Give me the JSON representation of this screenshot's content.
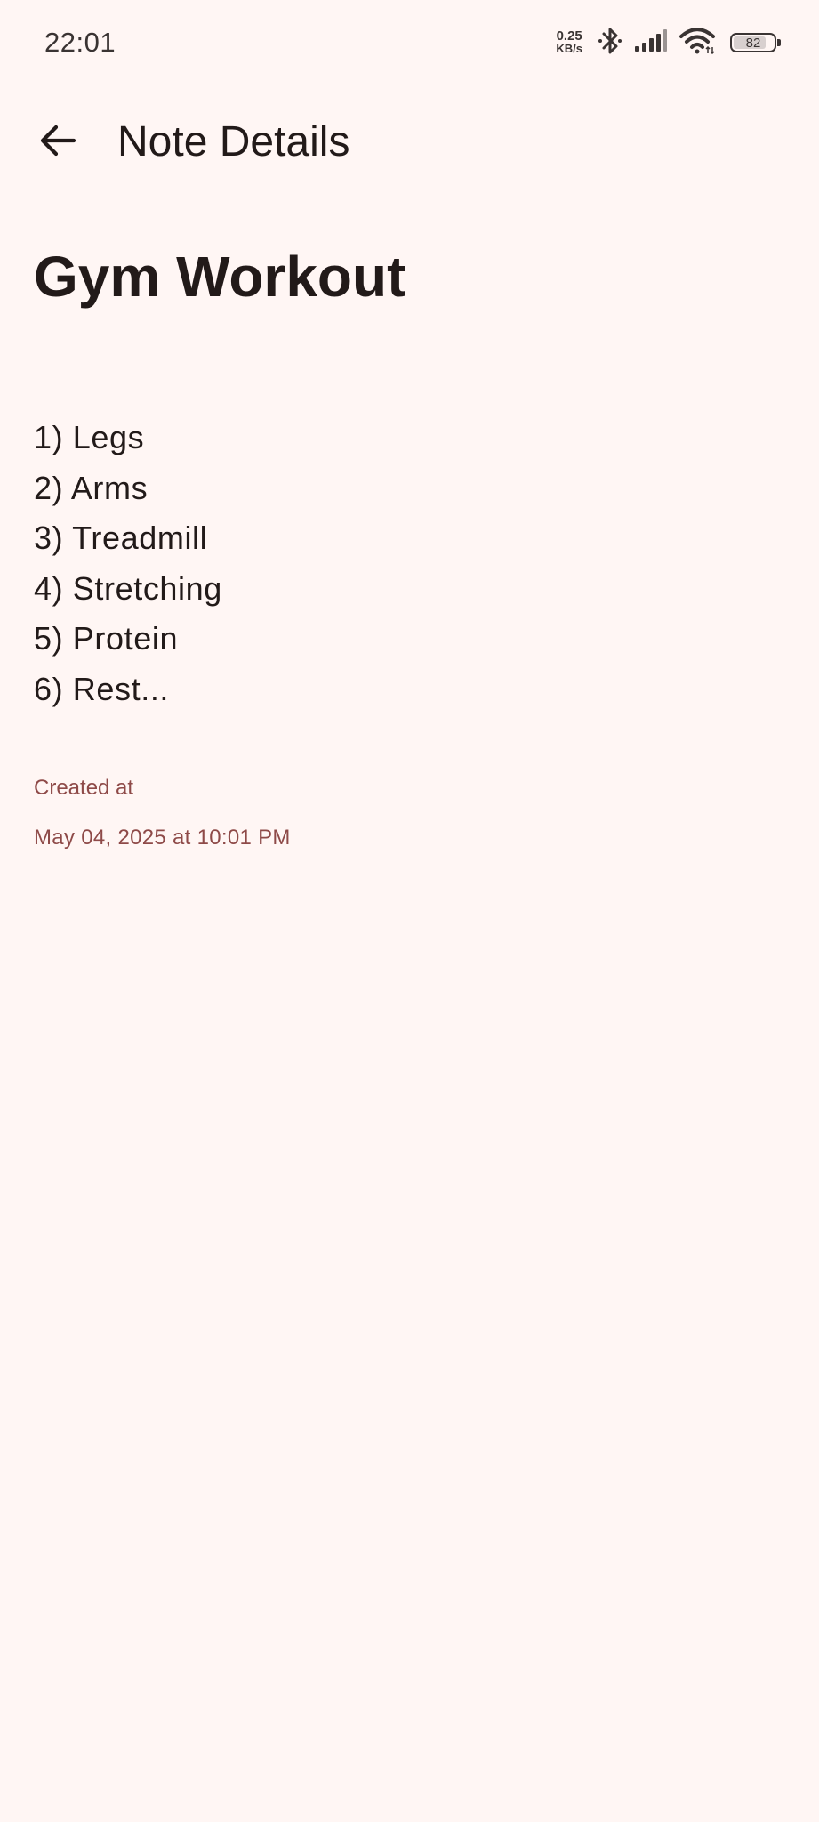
{
  "status_bar": {
    "time": "22:01",
    "net_speed_value": "0.25",
    "net_speed_unit": "KB/s",
    "battery_level": "82",
    "battery_fraction": 0.82,
    "icons": [
      "bluetooth-icon",
      "cellular-signal-icon",
      "wifi-icon",
      "battery-icon"
    ]
  },
  "app_bar": {
    "back_icon": "arrow-back-icon",
    "title": "Note Details"
  },
  "note": {
    "title": "Gym Workout",
    "lines": [
      "1) Legs",
      "2) Arms",
      "3) Treadmill",
      "4) Stretching",
      "5) Protein",
      "6) Rest..."
    ],
    "created_label": "Created at",
    "created_value": "May 04, 2025 at 10:01 PM"
  },
  "colors": {
    "background": "#FFF6F4",
    "text_primary": "#221A19",
    "accent": "#8E4A48",
    "status_icons": "#3A3433"
  }
}
